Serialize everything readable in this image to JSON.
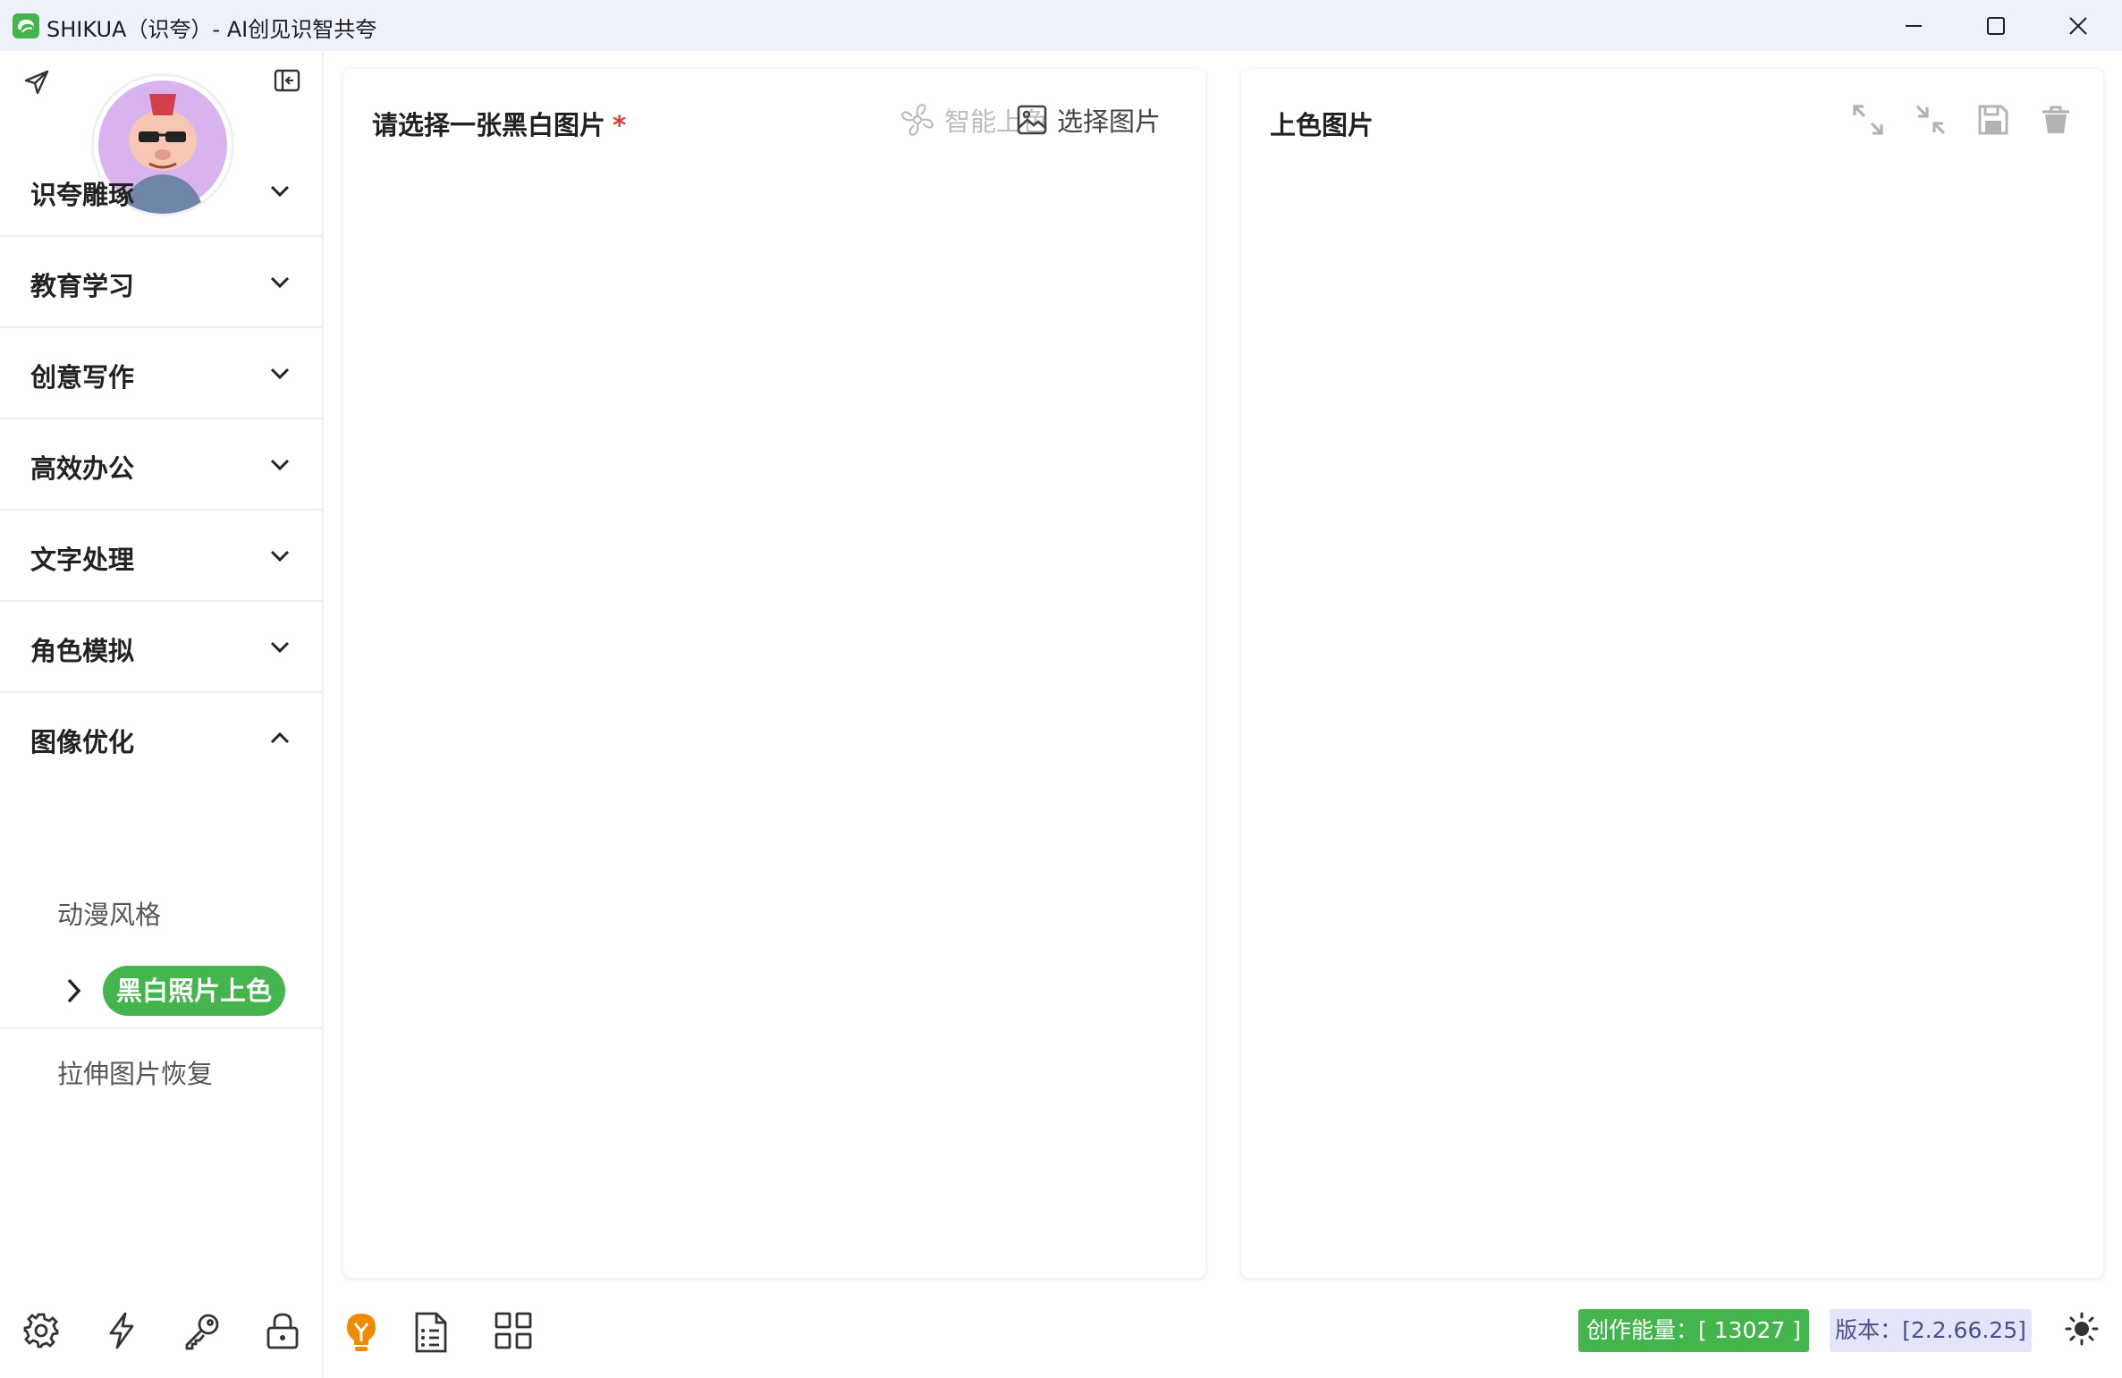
{
  "window": {
    "title": "SHIKUA（识夸）- AI创见识智共夸"
  },
  "sidebar": {
    "groups": [
      {
        "label": "识夸雕琢"
      },
      {
        "label": "教育学习"
      },
      {
        "label": "创意写作"
      },
      {
        "label": "高效办公"
      },
      {
        "label": "文字处理"
      },
      {
        "label": "角色模拟"
      },
      {
        "label": "图像优化"
      }
    ],
    "sub_items": [
      "动漫风格",
      "黑白照片上色",
      "拉伸图片恢复"
    ],
    "active_sub_item": "黑白照片上色"
  },
  "left_panel": {
    "title": "请选择一张黑白图片",
    "required_mark": "*",
    "colorize_button": "智能上色",
    "select_button": "选择图片"
  },
  "right_panel": {
    "title": "上色图片",
    "tools": [
      "expand-icon",
      "shrink-icon",
      "save-icon",
      "trash-icon"
    ]
  },
  "bottom": {
    "energy": "创作能量：[ 13027 ]",
    "version": "版本：[2.2.66.25]"
  },
  "colors": {
    "accent": "#43b54c",
    "titlebar": "#eef1fa",
    "version_bg": "#e3e6fb",
    "bulb": "#f08a00"
  }
}
